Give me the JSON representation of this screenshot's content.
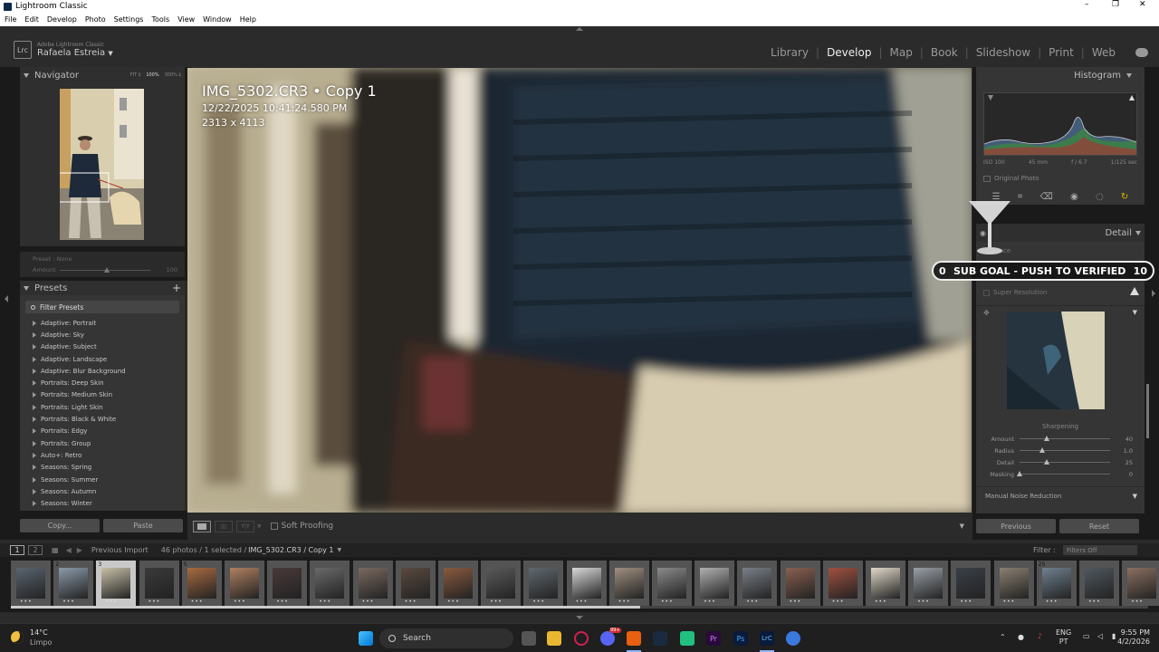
{
  "window": {
    "title": "Lightroom Classic",
    "minimize": "–",
    "maximize": "❐",
    "close": "✕"
  },
  "menu": [
    "File",
    "Edit",
    "Develop",
    "Photo",
    "Settings",
    "Tools",
    "View",
    "Window",
    "Help"
  ],
  "identity": {
    "app_small": "Adobe Lightroom Classic",
    "user": "Rafaela Estreia",
    "dropdown": "▼",
    "logo": "Lrc"
  },
  "modules": [
    "Library",
    "Develop",
    "Map",
    "Book",
    "Slideshow",
    "Print",
    "Web"
  ],
  "active_module": "Develop",
  "navigator": {
    "title": "Navigator",
    "fit": "FIT ‡",
    "z1": "100%",
    "z2": "300% ‡"
  },
  "preset_strip": {
    "preset_label": "Preset :",
    "preset_value": "None",
    "amount_label": "Amount",
    "amount_value": "100"
  },
  "presets": {
    "title": "Presets",
    "add": "+",
    "filter": "Filter Presets",
    "items": [
      "Adaptive: Portrait",
      "Adaptive: Sky",
      "Adaptive: Subject",
      "Adaptive: Landscape",
      "Adaptive: Blur Background",
      "Portraits: Deep Skin",
      "Portraits: Medium Skin",
      "Portraits: Light Skin",
      "Portraits: Black & White",
      "Portraits: Edgy",
      "Portraits: Group",
      "Auto+: Retro",
      "Seasons: Spring",
      "Seasons: Summer",
      "Seasons: Autumn",
      "Seasons: Winter"
    ]
  },
  "left_buttons": {
    "copy": "Copy...",
    "paste": "Paste"
  },
  "image_overlay": {
    "name": "IMG_5302.CR3  •  Copy 1",
    "datetime": "12/22/2025 10:41:24.580 PM",
    "dims": "2313 x 4113"
  },
  "toolbar": {
    "soft_proofing": "Soft Proofing"
  },
  "histogram": {
    "title": "Histogram",
    "iso": "ISO 100",
    "focal": "45 mm",
    "aperture": "f / 6.7",
    "shutter": "1/125 sec",
    "original": "Original Photo"
  },
  "detail": {
    "title": "Detail",
    "enhance": "Enhance",
    "super_res": "Super Resolution",
    "sharpening_title": "Sharpening",
    "sliders": [
      {
        "label": "Amount",
        "value": "40",
        "pos": 0.3
      },
      {
        "label": "Radius",
        "value": "1.0",
        "pos": 0.25
      },
      {
        "label": "Detail",
        "value": "25",
        "pos": 0.3
      },
      {
        "label": "Masking",
        "value": "0",
        "pos": 0.0
      }
    ],
    "noise": "Manual Noise Reduction"
  },
  "right_buttons": {
    "previous": "Previous",
    "reset": "Reset"
  },
  "goal": {
    "left": "0",
    "text": "SUB GOAL - PUSH TO VERIFIED",
    "right": "10"
  },
  "filmbar": {
    "v1": "1",
    "v2": "2",
    "source": "Previous Import",
    "count": "46 photos / 1 selected /",
    "file": "IMG_5302.CR3 / Copy 1",
    "filter_label": "Filter :",
    "filter_value": "Filters Off"
  },
  "film_numbers": [
    "",
    "2",
    "3",
    "",
    "5",
    "",
    "",
    "",
    "",
    "",
    "",
    "",
    "",
    "",
    "",
    "",
    "",
    "",
    "",
    "",
    "",
    "",
    "",
    "",
    "25",
    "",
    ""
  ],
  "taskbar": {
    "temp": "14°C",
    "weather": "Limpo",
    "search": "Search",
    "lang1": "ENG",
    "lang2": "PT",
    "time": "9:55 PM",
    "date": "4/2/2026",
    "badge": "99+"
  },
  "colors": {
    "accent": "#ffffff",
    "panel": "#353535",
    "bg": "#1a1a1a"
  }
}
